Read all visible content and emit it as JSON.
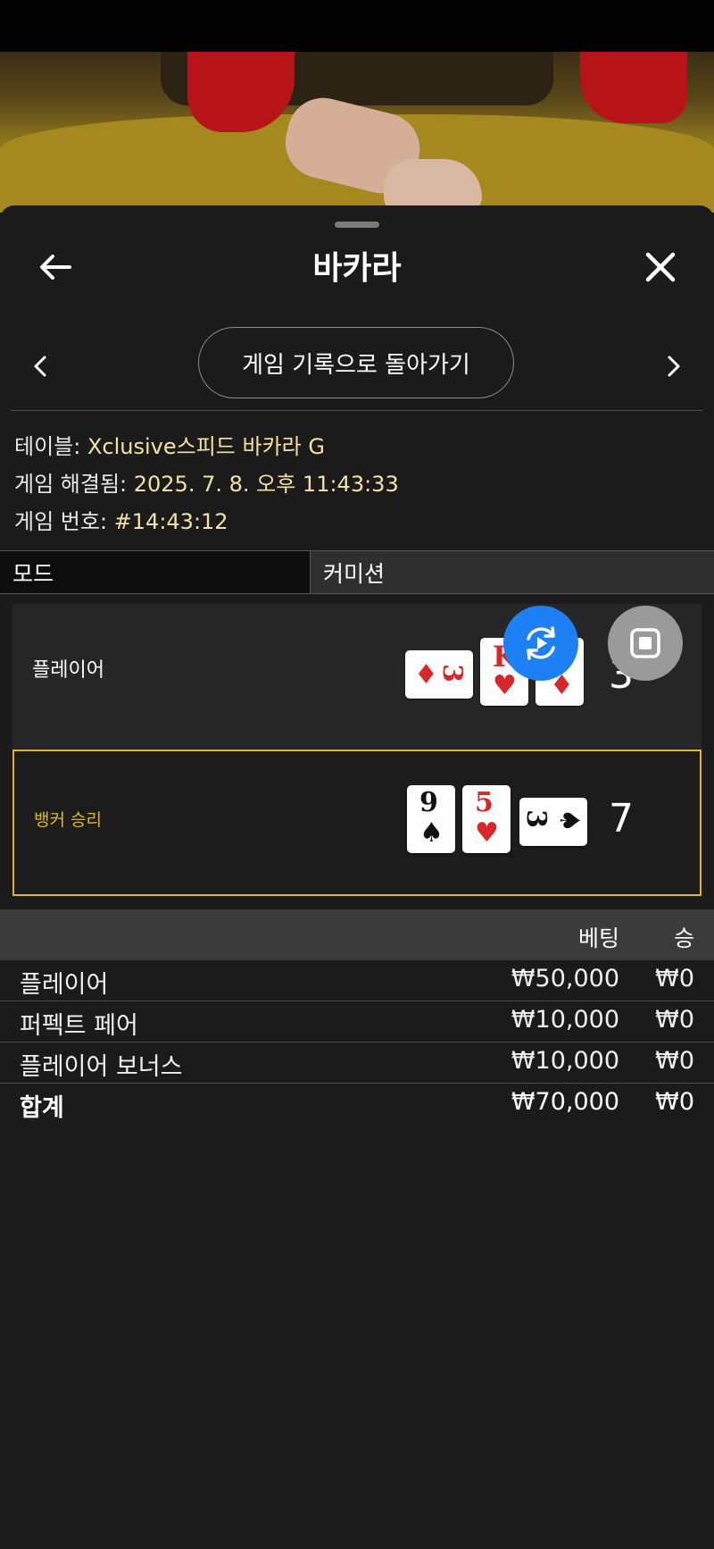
{
  "header": {
    "title": "바카라"
  },
  "nav": {
    "history_button": "게임 기록으로 돌아가기"
  },
  "info": {
    "table_label": "테이블: ",
    "table_value": "Xclusive스피드 바카라 G",
    "resolved_label": "게임 해결됨: ",
    "resolved_value": "2025. 7. 8. 오후 11:43:33",
    "number_label": "게임 번호: ",
    "number_value": "#14:43:12"
  },
  "tabs": {
    "mode": "모드",
    "commission": "커미션"
  },
  "hands": {
    "player": {
      "label": "플레이어",
      "score": "3",
      "cards": [
        {
          "rank": "3",
          "suit": "♦",
          "color": "red",
          "rotated": true
        },
        {
          "rank": "K",
          "suit": "♥",
          "color": "red",
          "rotated": false
        },
        {
          "rank": "",
          "suit": "♦",
          "color": "red",
          "rotated": false
        }
      ]
    },
    "banker": {
      "label": "뱅커 승리",
      "score": "7",
      "cards": [
        {
          "rank": "9",
          "suit": "♠",
          "color": "black",
          "rotated": false
        },
        {
          "rank": "5",
          "suit": "♥",
          "color": "red",
          "rotated": false
        },
        {
          "rank": "3",
          "suit": "♠",
          "color": "black",
          "rotated": true
        }
      ]
    }
  },
  "bets": {
    "header_bet": "베팅",
    "header_win": "승",
    "rows": [
      {
        "name": "플레이어",
        "amount": "₩50,000",
        "win": "₩0"
      },
      {
        "name": "퍼펙트 페어",
        "amount": "₩10,000",
        "win": "₩0"
      },
      {
        "name": "플레이어 보너스",
        "amount": "₩10,000",
        "win": "₩0"
      }
    ],
    "total": {
      "name": "합계",
      "amount": "₩70,000",
      "win": "₩0"
    }
  },
  "colors": {
    "highlight": "#e0b81d",
    "info_value": "#f3e2a6",
    "fab_blue": "#1d80f5"
  }
}
